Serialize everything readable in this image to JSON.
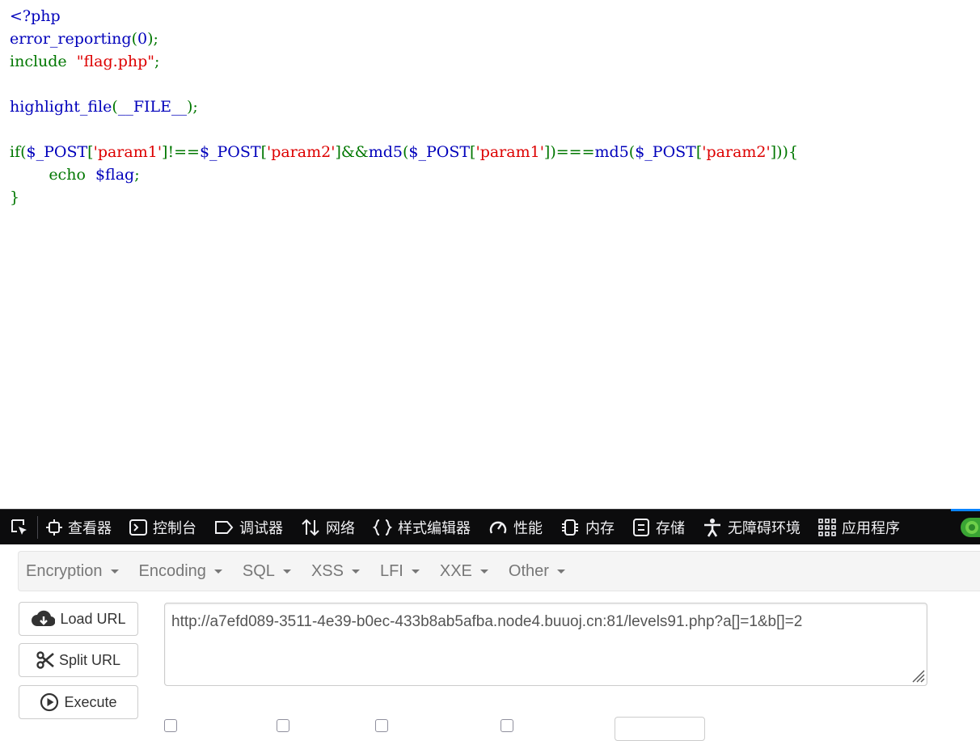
{
  "code_lines": [
    [
      {
        "t": "<?php",
        "c": "default"
      }
    ],
    [
      {
        "t": "error_reporting",
        "c": "default"
      },
      {
        "t": "(",
        "c": "keyword"
      },
      {
        "t": "0",
        "c": "default"
      },
      {
        "t": ");",
        "c": "keyword"
      }
    ],
    [
      {
        "t": "include  ",
        "c": "keyword"
      },
      {
        "t": "\"flag.php\"",
        "c": "string"
      },
      {
        "t": ";",
        "c": "keyword"
      }
    ],
    [],
    [
      {
        "t": "highlight_file",
        "c": "default"
      },
      {
        "t": "(",
        "c": "keyword"
      },
      {
        "t": "__FILE__",
        "c": "default"
      },
      {
        "t": ");",
        "c": "keyword"
      }
    ],
    [],
    [
      {
        "t": "if(",
        "c": "keyword"
      },
      {
        "t": "$_POST",
        "c": "default"
      },
      {
        "t": "[",
        "c": "keyword"
      },
      {
        "t": "'param1'",
        "c": "string"
      },
      {
        "t": "]!==",
        "c": "keyword"
      },
      {
        "t": "$_POST",
        "c": "default"
      },
      {
        "t": "[",
        "c": "keyword"
      },
      {
        "t": "'param2'",
        "c": "string"
      },
      {
        "t": "]&&",
        "c": "keyword"
      },
      {
        "t": "md5",
        "c": "default"
      },
      {
        "t": "(",
        "c": "keyword"
      },
      {
        "t": "$_POST",
        "c": "default"
      },
      {
        "t": "[",
        "c": "keyword"
      },
      {
        "t": "'param1'",
        "c": "string"
      },
      {
        "t": "])===",
        "c": "keyword"
      },
      {
        "t": "md5",
        "c": "default"
      },
      {
        "t": "(",
        "c": "keyword"
      },
      {
        "t": "$_POST",
        "c": "default"
      },
      {
        "t": "[",
        "c": "keyword"
      },
      {
        "t": "'param2'",
        "c": "string"
      },
      {
        "t": "])){",
        "c": "keyword"
      }
    ],
    [
      {
        "t": "        echo  ",
        "c": "keyword"
      },
      {
        "t": "$flag",
        "c": "default"
      },
      {
        "t": ";",
        "c": "keyword"
      }
    ],
    [
      {
        "t": "}",
        "c": "keyword"
      }
    ]
  ],
  "code_colors": {
    "default": "#0000bb",
    "keyword": "#007700",
    "string": "#dd0000"
  },
  "devtools": {
    "tabs": [
      {
        "label": "查看器",
        "icon": "inspector-icon"
      },
      {
        "label": "控制台",
        "icon": "console-icon"
      },
      {
        "label": "调试器",
        "icon": "debugger-icon"
      },
      {
        "label": "网络",
        "icon": "network-icon"
      },
      {
        "label": "样式编辑器",
        "icon": "style-editor-icon"
      },
      {
        "label": "性能",
        "icon": "performance-icon"
      },
      {
        "label": "内存",
        "icon": "memory-icon"
      },
      {
        "label": "存储",
        "icon": "storage-icon"
      },
      {
        "label": "无障碍环境",
        "icon": "accessibility-icon"
      },
      {
        "label": "应用程序",
        "icon": "application-icon"
      }
    ]
  },
  "hackbar": {
    "menus": [
      "Encryption",
      "Encoding",
      "SQL",
      "XSS",
      "LFI",
      "XXE",
      "Other"
    ],
    "load_url": "Load URL",
    "split_url": "Split URL",
    "execute": "Execute",
    "url_value": "http://a7efd089-3511-4e39-b0ec-433b8ab5afba.node4.buuoj.cn:81/levels91.php?a[]=1&b[]=2"
  }
}
